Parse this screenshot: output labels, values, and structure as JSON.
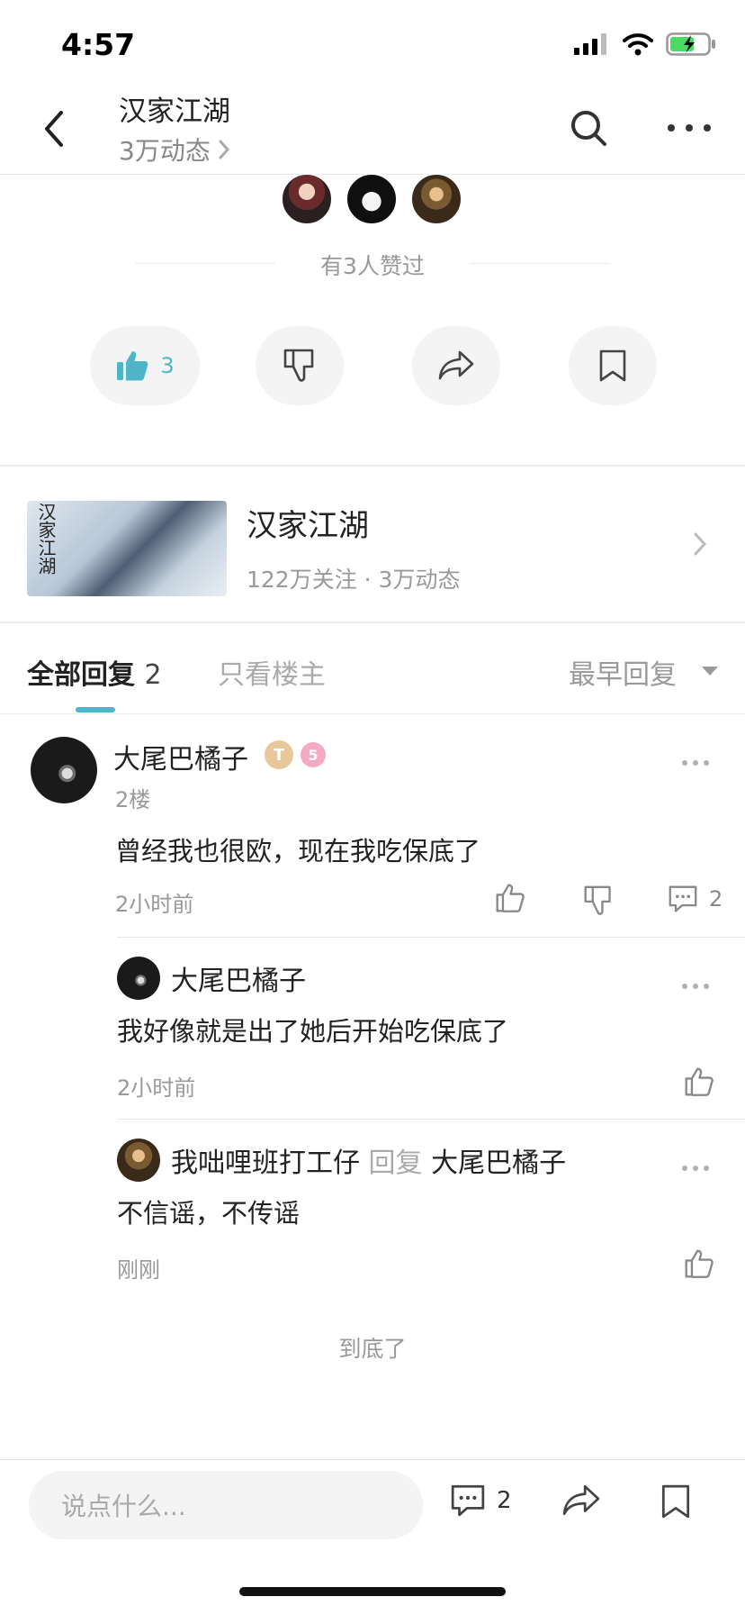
{
  "status_bar": {
    "time": "4:57"
  },
  "header": {
    "title": "汉家江湖",
    "subtitle": "3万动态"
  },
  "likes": {
    "summary": "有3人赞过",
    "like_count": "3"
  },
  "forum": {
    "name": "汉家江湖",
    "stats": "122万关注 · 3万动态",
    "cover_text": "汉家江湖"
  },
  "tabs": {
    "all_label": "全部回复",
    "all_count": "2",
    "op_only": "只看楼主",
    "sort": "最早回复"
  },
  "comment": {
    "author": "大尾巴橘子",
    "badge_t": "T",
    "badge_level": "5",
    "floor": "2楼",
    "body": "曾经我也很欧，现在我吃保底了",
    "time": "2小时前",
    "reply_count": "2"
  },
  "replies": [
    {
      "author": "大尾巴橘子",
      "body": "我好像就是出了她后开始吃保底了",
      "time": "2小时前"
    },
    {
      "author": "我咄哩班打工仔",
      "reply_word": "回复",
      "reply_to": "大尾巴橘子",
      "body": "不信谣，不传谣",
      "time": "刚刚"
    }
  ],
  "end_text": "到底了",
  "bottom_bar": {
    "placeholder": "说点什么...",
    "comment_count": "2"
  },
  "colors": {
    "accent": "#4fb6c8",
    "text": "#222222",
    "muted": "#999999"
  }
}
